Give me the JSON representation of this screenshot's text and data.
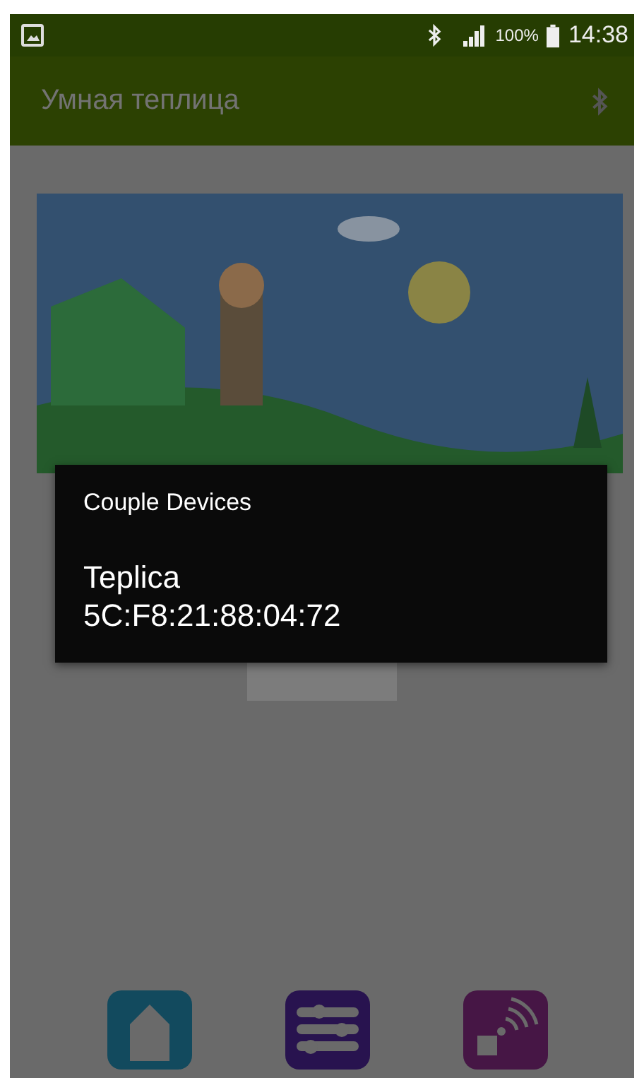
{
  "status_bar": {
    "battery": "100%",
    "time": "14:38"
  },
  "app_bar": {
    "title": "Умная теплица"
  },
  "dialog": {
    "title": "Couple Devices",
    "devices": [
      {
        "name": "Teplica",
        "address": "5C:F8:21:88:04:72"
      }
    ]
  },
  "bottom_nav": [
    {
      "kind": "home"
    },
    {
      "kind": "settings"
    },
    {
      "kind": "wireless"
    }
  ]
}
